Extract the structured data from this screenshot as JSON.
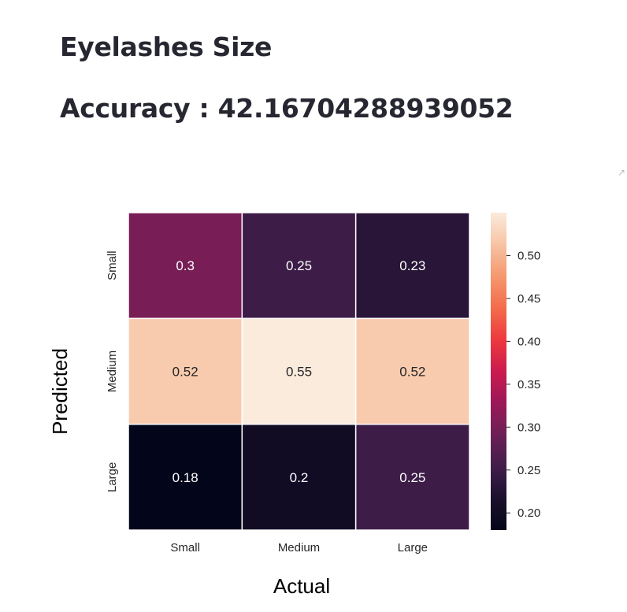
{
  "header": {
    "title": "Eyelashes Size",
    "accuracy": "Accuracy : 42.16704288939052"
  },
  "icons": {
    "expand": "expand-icon"
  },
  "chart_data": {
    "type": "heatmap",
    "xlabel": "Actual",
    "ylabel": "Predicted",
    "x_categories": [
      "Small",
      "Medium",
      "Large"
    ],
    "y_categories": [
      "Small",
      "Medium",
      "Large"
    ],
    "values": [
      [
        0.3,
        0.25,
        0.23
      ],
      [
        0.52,
        0.55,
        0.52
      ],
      [
        0.18,
        0.2,
        0.25
      ]
    ],
    "colorbar": {
      "min": 0.18,
      "max": 0.55,
      "ticks": [
        0.2,
        0.25,
        0.3,
        0.35,
        0.4,
        0.45,
        0.5
      ],
      "tick_labels": [
        "0.20",
        "0.25",
        "0.30",
        "0.35",
        "0.40",
        "0.45",
        "0.50"
      ],
      "colormap": "rocket"
    }
  }
}
